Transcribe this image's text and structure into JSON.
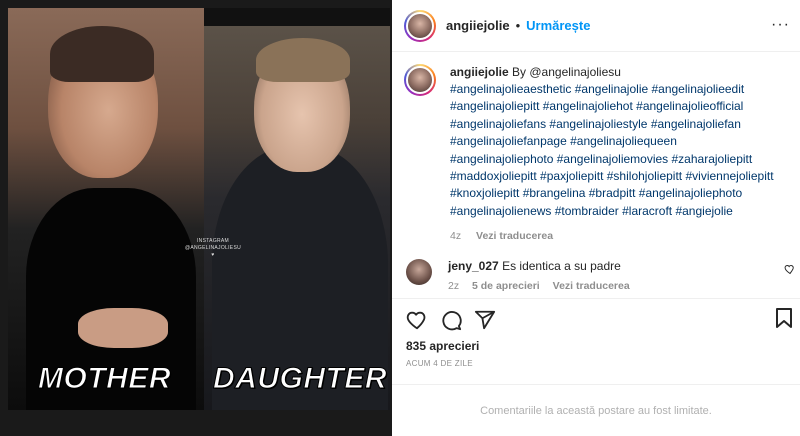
{
  "post": {
    "username": "angiiejolie",
    "separator": "•",
    "follow_label": "Urmărește",
    "more_label": "···",
    "media": {
      "watermark": "INSTAGRAM\n@ANGELINAJOLIESU ♥",
      "left_caption": "MOTHER",
      "right_caption": "DAUGHTER"
    }
  },
  "caption": {
    "username": "angiiejolie",
    "text": "By @angelinajoliesu",
    "hashtags": "#angelinajolieaesthetic #angelinajolie #angelinajolieedit #angelinajoliepitt #angelinajoliehot #angelinajolieofficial #angelinajoliefans #angelinajoliestyle #angelinajoliefan #angelinajoliefanpage #angelinajoliequeen #angelinajoliephoto #angelinajoliemovies #zaharajoliepitt #maddoxjoliepitt #paxjoliepitt #shilohjoliepitt #viviennejoliepitt #knoxjoliepitt #brangelina #bradpitt #angelinajoliephoto #angelinajolienews #tombraider #laracroft #angiejolie",
    "age": "4z",
    "translation_link": "Vezi traducerea"
  },
  "comments": [
    {
      "username": "jeny_027",
      "text": "Es identica a su padre",
      "age": "2z",
      "likes": "5 de aprecieri",
      "translation_link": "Vezi traducerea"
    }
  ],
  "actions": {
    "icons": [
      "heart-icon",
      "comment-icon",
      "share-icon",
      "bookmark-icon"
    ]
  },
  "stats": {
    "likes": "835 aprecieri",
    "posted": "ACUM 4 DE ZILE"
  },
  "footer": {
    "limited_notice": "Comentariile la această postare au fost limitate."
  }
}
